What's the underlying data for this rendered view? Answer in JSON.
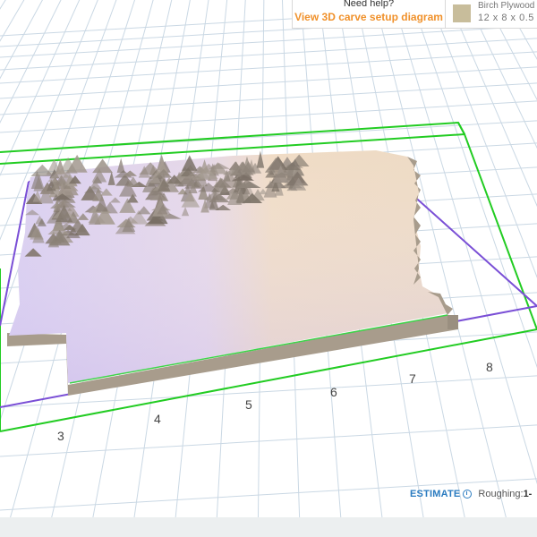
{
  "help": {
    "question": "Need help?",
    "link_label": "View 3D carve setup diagram"
  },
  "material": {
    "name": "Birch Plywood",
    "size": "12 x 8 x 0.5",
    "swatch_color": "#c8bd9b"
  },
  "axis": {
    "x_ticks": [
      "3",
      "4",
      "5",
      "6",
      "7",
      "8"
    ]
  },
  "estimate": {
    "label": "ESTIMATE",
    "roughing_label": "Roughing:",
    "roughing_value": "1-"
  },
  "colors": {
    "grid": "#c9d8e6",
    "work_area_outline": "#22cc22",
    "stock_outline": "#7a4fd6",
    "model_base": "#a89c8c",
    "model_top_light": "#efdcc4",
    "model_top_shaded": "#d8c8ec",
    "accent_link": "#f0912b",
    "estimate_blue": "#2a7bc0"
  }
}
